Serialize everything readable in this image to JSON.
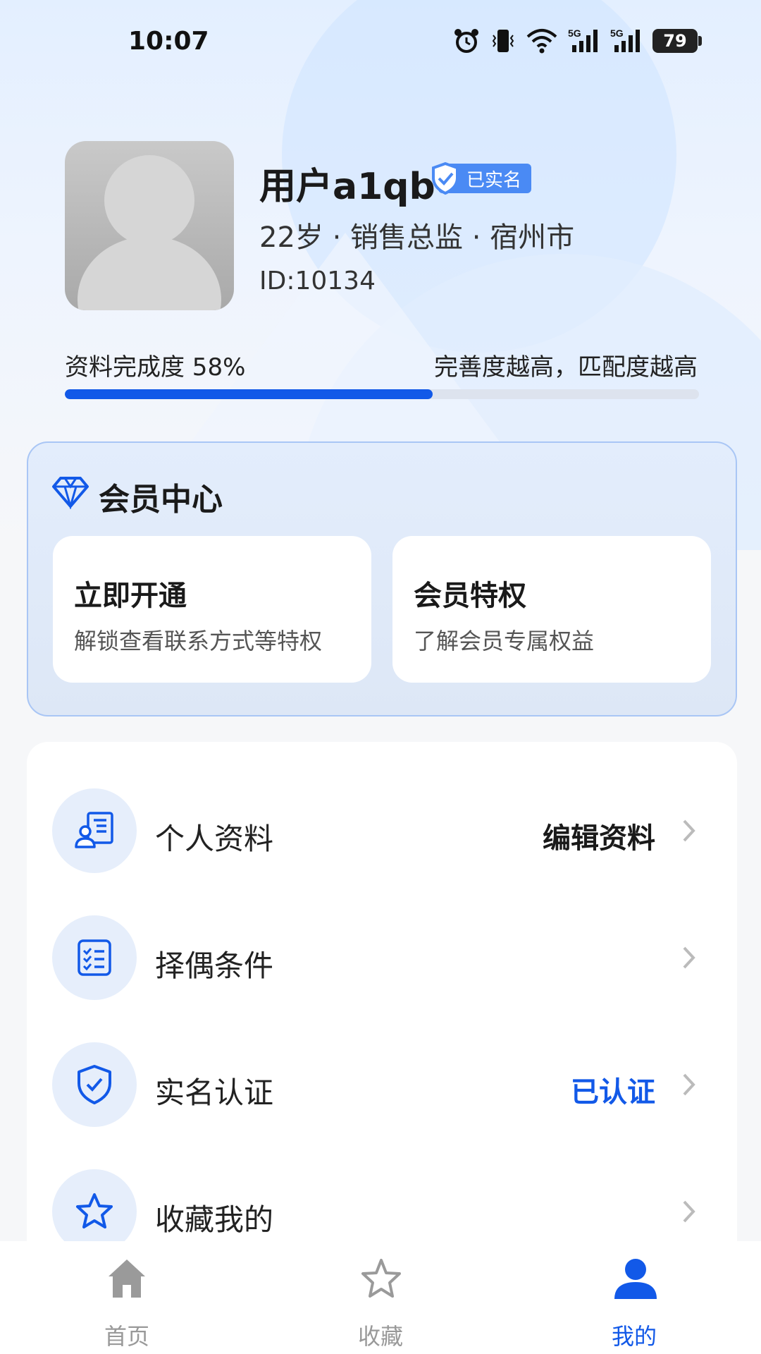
{
  "status_bar": {
    "time": "10:07",
    "battery": "79",
    "signal1": "5G",
    "signal2": "5G"
  },
  "profile": {
    "username": "用户a1qb",
    "verified_badge": "已实名",
    "meta": "22岁 · 销售总监 · 宿州市",
    "id": "ID:10134"
  },
  "completion": {
    "label": "资料完成度 58%",
    "value": 0.58,
    "hint": "完善度越高，匹配度越高",
    "fill_color": "#1259e8"
  },
  "member_center": {
    "title": "会员中心",
    "cards": [
      {
        "title": "立即开通",
        "subtitle": "解锁查看联系方式等特权"
      },
      {
        "title": "会员特权",
        "subtitle": "了解会员专属权益"
      }
    ]
  },
  "menu": [
    {
      "icon": "profile-card-icon",
      "label": "个人资料",
      "value": "编辑资料",
      "value_color": "#1a1a1a"
    },
    {
      "icon": "checklist-icon",
      "label": "择偶条件",
      "value": ""
    },
    {
      "icon": "shield-check-icon",
      "label": "实名认证",
      "value": "已认证",
      "value_color": "#1259e8"
    },
    {
      "icon": "star-icon",
      "label": "收藏我的",
      "value": ""
    }
  ],
  "tabbar": {
    "items": [
      {
        "icon": "home-icon",
        "label": "首页",
        "active": false
      },
      {
        "icon": "star-icon",
        "label": "收藏",
        "active": false
      },
      {
        "icon": "user-icon",
        "label": "我的",
        "active": true
      }
    ],
    "active_color": "#1259e8"
  }
}
